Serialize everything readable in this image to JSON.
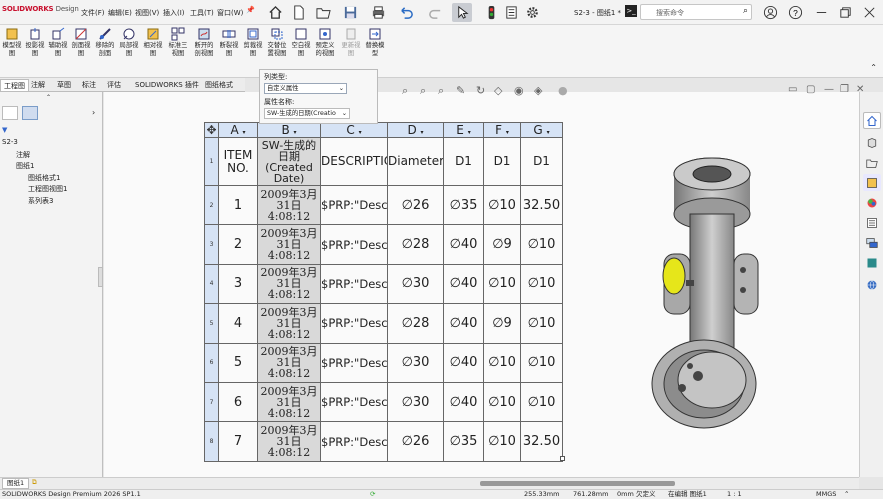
{
  "app": {
    "logo_brand": "SOLIDWORKS",
    "logo_suffix": "Design",
    "doc_name": "S2-3 - 图纸1 *",
    "search_placeholder": "搜索命令"
  },
  "menu": [
    "文件(F)",
    "编辑(E)",
    "视图(V)",
    "插入(I)",
    "工具(T)",
    "窗口(W)"
  ],
  "ribbon": [
    "模型视图",
    "投影视图",
    "辅助视图",
    "剖面视图",
    "移除的剖面",
    "局部视图",
    "相对视图",
    "标准三视图",
    "断开的剖视图",
    "断裂视图",
    "剪裁视图",
    "交替位置视图",
    "空白视图",
    "预定义的视图",
    "更新视图",
    "替换模型"
  ],
  "tabs": [
    "工程图",
    "注解",
    "草图",
    "标注",
    "评估",
    "SOLIDWORKS 插件",
    "图纸格式"
  ],
  "tree": {
    "root": "S2-3",
    "items": [
      "注解",
      "图纸1",
      "图纸格式1",
      "工程图视图1",
      "系列表3"
    ]
  },
  "popup": {
    "col_type_label": "列类型:",
    "col_type_value": "自定义属性",
    "prop_name_label": "属性名称:",
    "prop_name_value": "SW-生成的日期(Creatio"
  },
  "table": {
    "col_letters": [
      "A",
      "B",
      "C",
      "D",
      "E",
      "F",
      "G"
    ],
    "row_numbers": [
      "1",
      "2",
      "3",
      "4",
      "5",
      "6",
      "7",
      "8"
    ],
    "headers": [
      "ITEM NO.",
      "SW-生成的日期(Created Date)",
      "DESCRIPTION",
      "Diameter",
      "D1",
      "D1",
      "D1"
    ],
    "rows": [
      [
        "1",
        "2009年3月31日 4:08:12",
        "$PRP:\"Description\"",
        "∅26",
        "∅35",
        "∅10",
        "32.50"
      ],
      [
        "2",
        "2009年3月31日 4:08:12",
        "$PRP:\"Description\"",
        "∅28",
        "∅40",
        "∅9",
        "∅10"
      ],
      [
        "3",
        "2009年3月31日 4:08:12",
        "$PRP:\"Description\"",
        "∅30",
        "∅40",
        "∅10",
        "∅10"
      ],
      [
        "4",
        "2009年3月31日 4:08:12",
        "$PRP:\"Description\"",
        "∅28",
        "∅40",
        "∅9",
        "∅10"
      ],
      [
        "5",
        "2009年3月31日 4:08:12",
        "$PRP:\"Description\"",
        "∅30",
        "∅40",
        "∅10",
        "∅10"
      ],
      [
        "6",
        "2009年3月31日 4:08:12",
        "$PRP:\"Description\"",
        "∅30",
        "∅40",
        "∅10",
        "∅10"
      ],
      [
        "7",
        "2009年3月31日 4:08:12",
        "$PRP:\"Description\"",
        "∅26",
        "∅35",
        "∅10",
        "32.50"
      ]
    ]
  },
  "sheet_tab": "图纸1",
  "status": {
    "product": "SOLIDWORKS Design Premium 2026 SP1.1",
    "x": "255.33mm",
    "y": "761.28mm",
    "z": "0mm",
    "mode": "欠定义",
    "editing": "在编辑 图纸1",
    "scale": "1 : 1",
    "units": "MMGS"
  }
}
